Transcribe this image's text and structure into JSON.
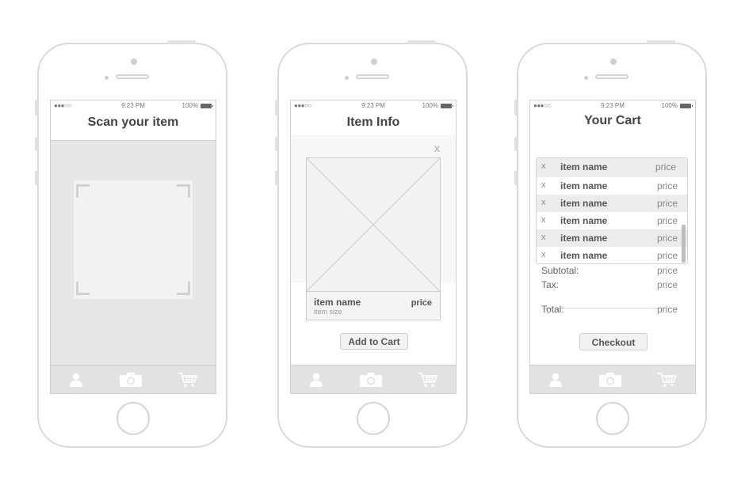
{
  "status_bar": {
    "signal": "●●●○○",
    "time": "9:23 PM",
    "battery": "100%"
  },
  "screens": [
    {
      "title": "Scan your item"
    },
    {
      "title": "Item Info",
      "close": "x",
      "item": {
        "name": "item name",
        "size": "item size",
        "price": "price"
      },
      "add_to_cart": "Add to Cart"
    },
    {
      "title": "Your Cart",
      "cart_items": [
        {
          "remove": "x",
          "name": "item name",
          "price": "price"
        },
        {
          "remove": "x",
          "name": "item name",
          "price": "price"
        },
        {
          "remove": "x",
          "name": "item name",
          "price": "price"
        },
        {
          "remove": "x",
          "name": "item name",
          "price": "price"
        },
        {
          "remove": "x",
          "name": "item name",
          "price": "price"
        },
        {
          "remove": "x",
          "name": "item name",
          "price": "price"
        }
      ],
      "subtotal_label": "Subtotal:",
      "subtotal_value": "price",
      "tax_label": "Tax:",
      "tax_value": "price",
      "total_label": "Total:",
      "total_value": "price",
      "checkout": "Checkout"
    }
  ],
  "tab_icons": [
    "user-icon",
    "camera-icon",
    "cart-icon"
  ],
  "colors": {
    "tab_bar": "#e2e2e2",
    "wireframe_gray": "#d0d0d0"
  }
}
